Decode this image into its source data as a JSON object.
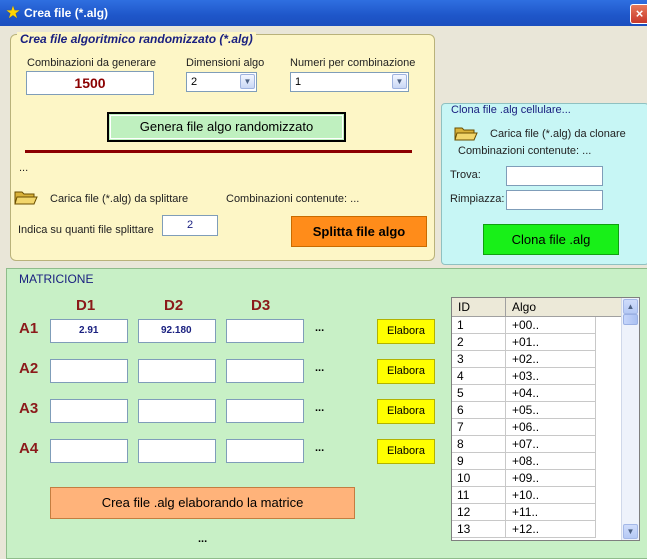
{
  "window": {
    "title": "Crea file (*.alg)",
    "close_label": "×"
  },
  "create_panel": {
    "legend": "Crea file algoritmico randomizzato (*.alg)",
    "combinazioni_label": "Combinazioni da generare",
    "combinazioni_value": "1500",
    "dimensioni_label": "Dimensioni algo",
    "dimensioni_value": "2",
    "numeri_label": "Numeri per combinazione",
    "numeri_value": "1",
    "genera_button": "Genera file algo randomizzato",
    "ellipsis": "...",
    "carica_split_label": "Carica file (*.alg) da splittare",
    "combinazioni_contenute": "Combinazioni contenute: ...",
    "indica_label": "Indica su quanti file splittare",
    "split_count_value": "2",
    "splitta_button": "Splitta file algo"
  },
  "clone_panel": {
    "legend": "Clona file .alg cellulare...",
    "carica_label": "Carica file (*.alg) da clonare",
    "combinazioni_contenute": "Combinazioni contenute: ...",
    "trova_label": "Trova:",
    "rimpiazza_label": "Rimpiazza:",
    "trova_value": "",
    "rimpiazza_value": "",
    "clona_button": "Clona file .alg"
  },
  "matrix_panel": {
    "legend": "MATRICIONE",
    "columns": [
      "D1",
      "D2",
      "D3"
    ],
    "rows": [
      {
        "label": "A1",
        "cells": [
          "2.91",
          "92.180",
          ""
        ],
        "dots": "...",
        "button": "Elabora"
      },
      {
        "label": "A2",
        "cells": [
          "",
          "",
          ""
        ],
        "dots": "...",
        "button": "Elabora"
      },
      {
        "label": "A3",
        "cells": [
          "",
          "",
          ""
        ],
        "dots": "...",
        "button": "Elabora"
      },
      {
        "label": "A4",
        "cells": [
          "",
          "",
          ""
        ],
        "dots": "...",
        "button": "Elabora"
      }
    ],
    "crea_button": "Crea file .alg elaborando la matrice",
    "bottom_dots": "..."
  },
  "grid": {
    "headers": [
      "ID",
      "Algo"
    ],
    "rows": [
      [
        "1",
        "+00.."
      ],
      [
        "2",
        "+01.."
      ],
      [
        "3",
        "+02.."
      ],
      [
        "4",
        "+03.."
      ],
      [
        "5",
        "+04.."
      ],
      [
        "6",
        "+05.."
      ],
      [
        "7",
        "+06.."
      ],
      [
        "8",
        "+07.."
      ],
      [
        "9",
        "+08.."
      ],
      [
        "10",
        "+09.."
      ],
      [
        "11",
        "+10.."
      ],
      [
        "12",
        "+11.."
      ],
      [
        "13",
        "+12.."
      ]
    ]
  }
}
